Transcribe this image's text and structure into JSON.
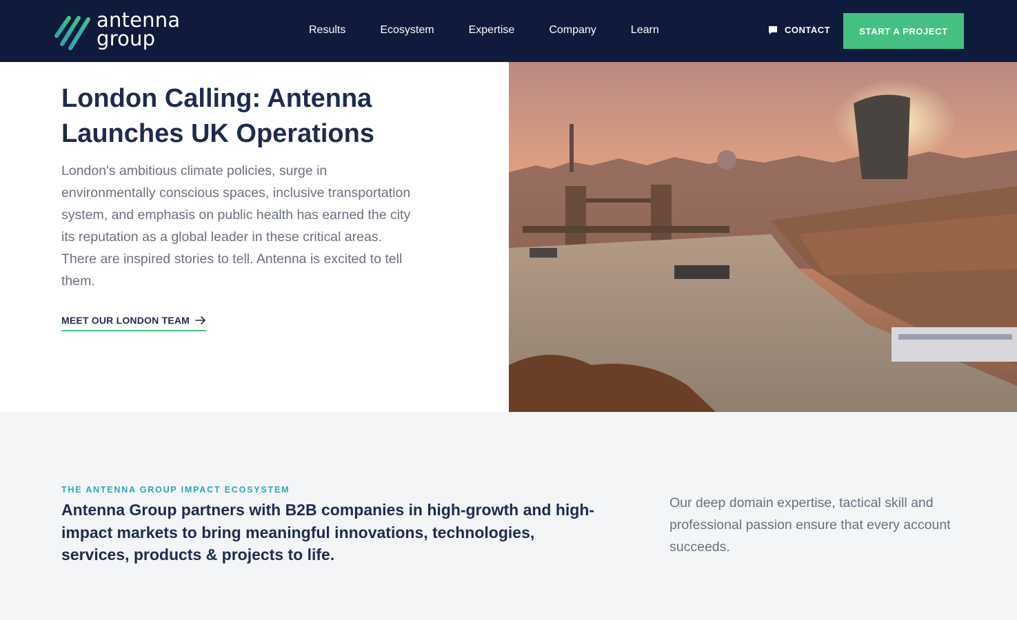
{
  "brand": {
    "logo_line1": "antenna",
    "logo_line2": "group",
    "colors": {
      "navy": "#101a3c",
      "heading": "#1d2b52",
      "green": "#44c182",
      "teal": "#2aa7b6",
      "muted": "#6a7080",
      "section_bg": "#f4f5f7"
    }
  },
  "nav": {
    "items": [
      {
        "label": "Results"
      },
      {
        "label": "Ecosystem"
      },
      {
        "label": "Expertise"
      },
      {
        "label": "Company"
      },
      {
        "label": "Learn"
      }
    ],
    "contact_label": "CONTACT",
    "contact_icon": "chat-bubble-icon",
    "cta_label": "START A PROJECT"
  },
  "hero": {
    "title": "London Calling: Antenna Launches UK Operations",
    "body": "London's ambitious climate policies, surge in environmentally conscious spaces, inclusive transportation system, and emphasis on public health has earned the city its reputation as a global leader in these critical areas. There are inspired stories to tell. Antenna is excited to tell them.",
    "link_label": "MEET OUR LONDON TEAM",
    "link_icon": "arrow-right-icon",
    "image_alt": "London skyline at sunset over the Thames with Tower Bridge"
  },
  "ecosystem": {
    "eyebrow": "THE ANTENNA GROUP IMPACT ECOSYSTEM",
    "heading": "Antenna Group partners with B2B companies in high-growth and high-impact markets to bring meaningful innovations, technologies, services, products & projects to life.",
    "side_text": "Our deep domain expertise, tactical skill and professional passion ensure that every account succeeds."
  }
}
